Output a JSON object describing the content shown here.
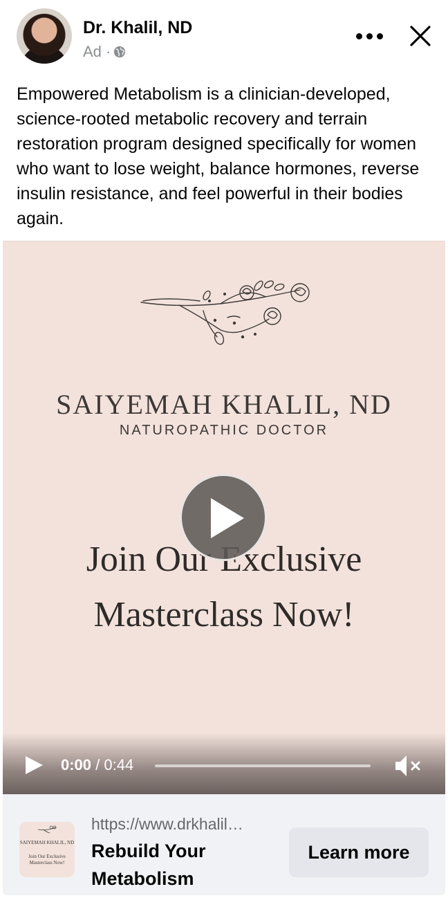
{
  "post": {
    "page_name": "Dr. Khalil, ND",
    "ad_label": "Ad · ",
    "body_text": "Empowered Metabolism is a clinician-developed, science-rooted metabolic recovery and terrain restoration program designed specifically for women who want to lose weight, balance hormones, reverse insulin resistance, and feel powerful in their bodies again."
  },
  "video": {
    "brand_name": "SAIYEMAH KHALIL, ND",
    "brand_subtitle": "NATUROPATHIC DOCTOR",
    "headline_line1": "Join Our Exclusive",
    "headline_line2": "Masterclass Now!",
    "current_time": "0:00",
    "separator": " / ",
    "duration": "0:44",
    "progress": 0
  },
  "link": {
    "url": "https://www.drkhalil…",
    "title": "Rebuild Your Metabolism",
    "cta_label": "Learn more",
    "thumb_line1": "SAIYEMAH KHALIL, ND",
    "thumb_line2": "Join Our Exclusive Masterclass Now!"
  },
  "icons": [
    "globe-icon",
    "more-options-icon",
    "close-icon",
    "play-icon",
    "mute-icon",
    "floral-logo"
  ]
}
